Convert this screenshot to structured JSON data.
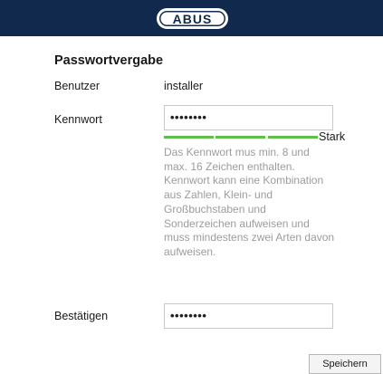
{
  "header": {
    "logo_text": "ABUS",
    "background": "#12294e"
  },
  "form": {
    "title": "Passwortvergabe",
    "user_label": "Benutzer",
    "user_value": "installer",
    "password_label": "Kennwort",
    "password_value": "••••••••",
    "strength_label": "Stark",
    "strength_color": "#5fbf4d",
    "strength_level": 1.0,
    "hint": "Das Kennwort mus min. 8 und max. 16 Zeichen enthalten. Kennwort kann eine Kombination aus Zahlen, Klein- und Großbuchstaben und Sonderzeichen aufweisen und muss mindestens zwei Arten davon aufweisen.",
    "confirm_label": "Bestätigen",
    "confirm_value": "••••••••"
  },
  "actions": {
    "save_label": "Speichern"
  }
}
